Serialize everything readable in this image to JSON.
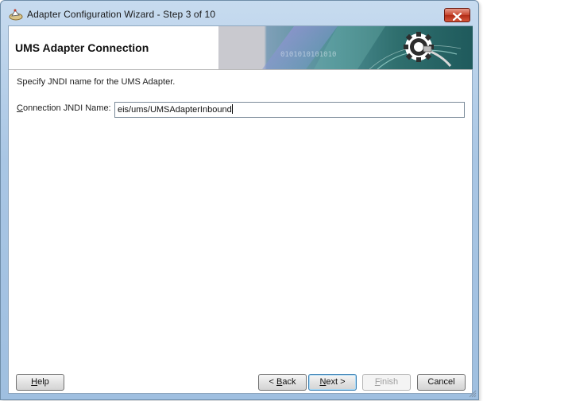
{
  "window": {
    "title": "Adapter Configuration Wizard - Step 3 of 10"
  },
  "header": {
    "title": "UMS Adapter Connection",
    "banner_text": "0101010101010"
  },
  "content": {
    "instruction": "Specify JNDI name for the UMS Adapter.",
    "jndi_label_mnemonic": "C",
    "jndi_label_rest": "onnection JNDI Name:",
    "jndi_value": "eis/ums/UMSAdapterInbound"
  },
  "buttons": {
    "help_mnemonic": "H",
    "help_rest": "elp",
    "back_prefix": "< ",
    "back_mnemonic": "B",
    "back_rest": "ack",
    "next_mnemonic": "N",
    "next_rest": "ext >",
    "finish_mnemonic": "F",
    "finish_rest": "inish",
    "cancel_label": "Cancel"
  },
  "colors": {
    "title_bar": "#a9c6e4",
    "close_button": "#c7442d",
    "banner_dark": "#3f7d7f",
    "banner_purple": "#8a86c8"
  },
  "icons": [
    "app-icon",
    "close-icon",
    "gear-plug-icon",
    "resize-grip-icon"
  ]
}
